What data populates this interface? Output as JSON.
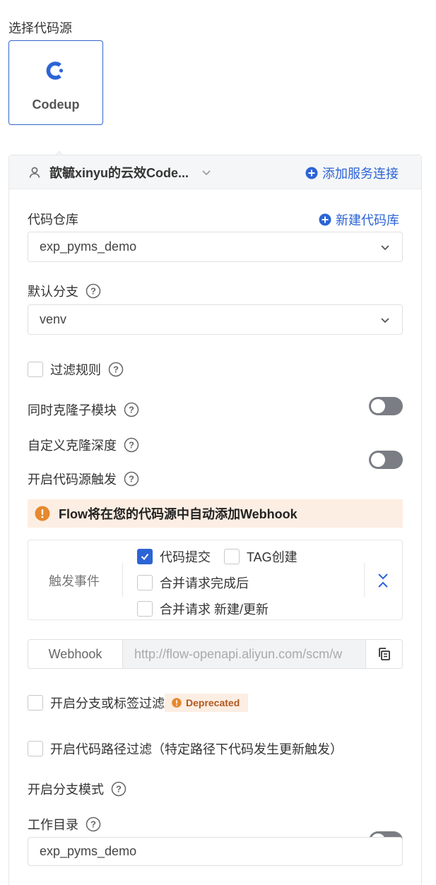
{
  "source": {
    "section_title": "选择代码源",
    "selected": "Codeup"
  },
  "connection": {
    "name": "歆毓xinyu的云效Code...",
    "add_link": "添加服务连接"
  },
  "repo": {
    "label": "代码仓库",
    "new_link": "新建代码库",
    "value": "exp_pyms_demo"
  },
  "branch": {
    "label": "默认分支",
    "value": "venv"
  },
  "filter_rules": {
    "label": "过滤规则",
    "checked": false
  },
  "clone_submodules": {
    "label": "同时克隆子模块",
    "enabled": false
  },
  "clone_depth": {
    "label": "自定义克隆深度",
    "enabled": false
  },
  "trigger": {
    "label": "开启代码源触发",
    "enabled": true,
    "notice": "Flow将在您的代码源中自动添加Webhook",
    "events_label": "触发事件",
    "events": [
      {
        "label": "代码提交",
        "checked": true
      },
      {
        "label": "TAG创建",
        "checked": false
      },
      {
        "label": "合并请求完成后",
        "checked": false
      },
      {
        "label": "合并请求 新建/更新",
        "checked": false
      }
    ],
    "webhook_label": "Webhook",
    "webhook_url": "http://flow-openapi.aliyun.com/scm/w"
  },
  "branch_tag_filter": {
    "label": "开启分支或标签过滤",
    "badge": "Deprecated",
    "checked": false
  },
  "path_filter": {
    "label": "开启代码路径过滤（特定路径下代码发生更新触发）",
    "checked": false
  },
  "branch_mode": {
    "label": "开启分支模式",
    "enabled": false
  },
  "workdir": {
    "label": "工作目录",
    "value": "exp_pyms_demo"
  },
  "colors": {
    "primary": "#2c64d6",
    "warning": "#e6892e",
    "notice_bg": "#fdeee3",
    "toggle_off": "#7a7d83"
  }
}
